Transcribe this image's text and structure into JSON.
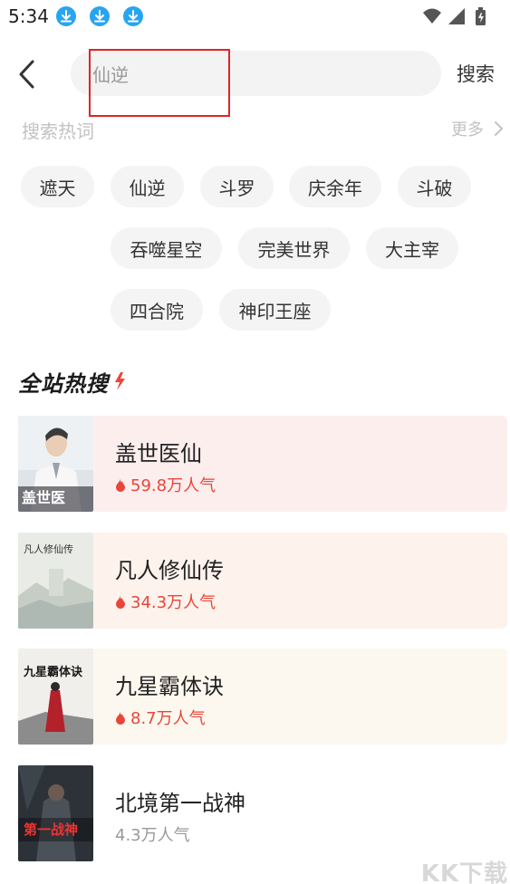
{
  "status_bar": {
    "time": "5:34",
    "download_icons": [
      "download-icon",
      "download-icon",
      "download-icon"
    ],
    "right_icons": [
      "wifi-icon",
      "signal-icon",
      "battery-icon"
    ]
  },
  "header": {
    "back_icon": "chevron-left-icon",
    "search_value": "仙逆",
    "search_button_label": "搜索"
  },
  "hot_words": {
    "title": "搜索热词",
    "more_label": "更多",
    "more_icon": "chevron-right-icon",
    "tags": [
      "遮天",
      "仙逆",
      "斗罗",
      "庆余年",
      "斗破",
      "吞噬星空",
      "完美世界",
      "大主宰",
      "四合院",
      "神印王座"
    ]
  },
  "ranking": {
    "title": "全站热搜",
    "items": [
      {
        "name": "盖世医仙",
        "popularity": "59.8万人气",
        "hot": true,
        "cover_text": "盖世医",
        "accent": "#e8463a",
        "bg": "#fdeeee"
      },
      {
        "name": "凡人修仙传",
        "popularity": "34.3万人气",
        "hot": true,
        "cover_text": "凡人修仙传",
        "accent": "#e8463a",
        "bg": "#fdf3ec"
      },
      {
        "name": "九星霸体诀",
        "popularity": "8.7万人气",
        "hot": true,
        "cover_text": "九星霸体诀",
        "accent": "#e8463a",
        "bg": "#fdf8ef"
      },
      {
        "name": "北境第一战神",
        "popularity": "4.3万人气",
        "hot": false,
        "cover_text": "第一战神",
        "accent": "#999999",
        "bg": "#ffffff"
      }
    ]
  },
  "watermark": "KK下载"
}
